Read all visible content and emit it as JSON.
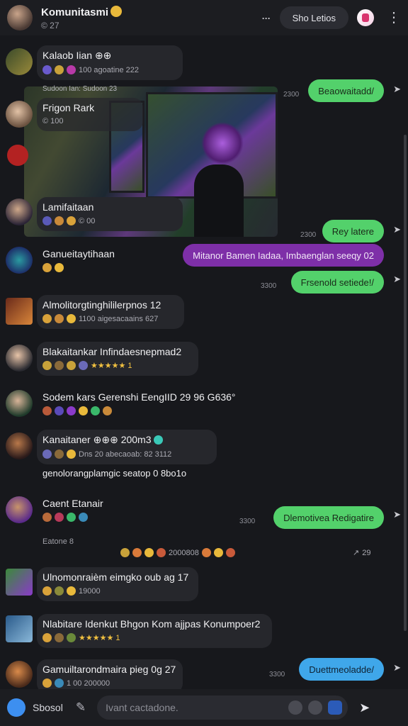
{
  "header": {
    "title": "Komunitasmi",
    "subtitle": "© 27",
    "more_label": "···",
    "action_label": "Sho Letios",
    "menu_icon": "vertical-dots-icon"
  },
  "media_caption": "Sudoon Ian: Sudoon 23",
  "incoming": [
    {
      "name": "Kalaob Iian ⊕⊕",
      "meta": "100 agoatine 222"
    },
    {
      "name": "Frigon Rark",
      "meta": "© 100"
    },
    {
      "name": "Lamifaitaan",
      "meta": "© 00"
    },
    {
      "name": "Ganueitaytihaan",
      "meta": ""
    },
    {
      "name": "Almolitorgtinghililerpnos 12",
      "meta": "1100 aigesacaains 627"
    },
    {
      "name": "Blakaitankar Infindaesnepmad2",
      "meta": "★★★★★ 1"
    },
    {
      "name": "Sodem kars Gerenshi EengIID 29 96 G636°",
      "meta": ""
    },
    {
      "name": "Kanaitaner ⊕⊕⊕ 200m3",
      "meta": "Dns 20 abecaoab: 82 3112"
    },
    {
      "name": "Caent Etanair",
      "meta": ""
    },
    {
      "name": "Ulnomonraièm eimgko oub ag 17",
      "meta": "19000"
    },
    {
      "name": "Nlabitare Idenkut Bhgon Kom ajjpas Konumpoer2",
      "meta": "★★★★★ 1"
    },
    {
      "name": "Gamuiltarondmaira pieg 0g 27",
      "meta": "1 00 200000"
    }
  ],
  "extra_line": "genolorangplamgic seatop 0 8bo1o",
  "system_line": "Eatone 8",
  "reaction_line": "2000808",
  "reaction_count": "29",
  "outgoing": [
    {
      "text": "Beaowaitadd/",
      "time": "2300"
    },
    {
      "text": "Rey latere",
      "time": "2300"
    },
    {
      "text": "Mitanor Bamen Iadaa, Imbaenglan seeqy 02",
      "time": ""
    },
    {
      "text": "Frsenold setiede!/",
      "time": "3300"
    },
    {
      "text": "Dlemotivea Redigatire",
      "time": "3300"
    },
    {
      "text": "Duettmeoladde/",
      "time": "3300"
    }
  ],
  "composer": {
    "label": "Sbosol",
    "placeholder": "Ivant cactadone."
  }
}
